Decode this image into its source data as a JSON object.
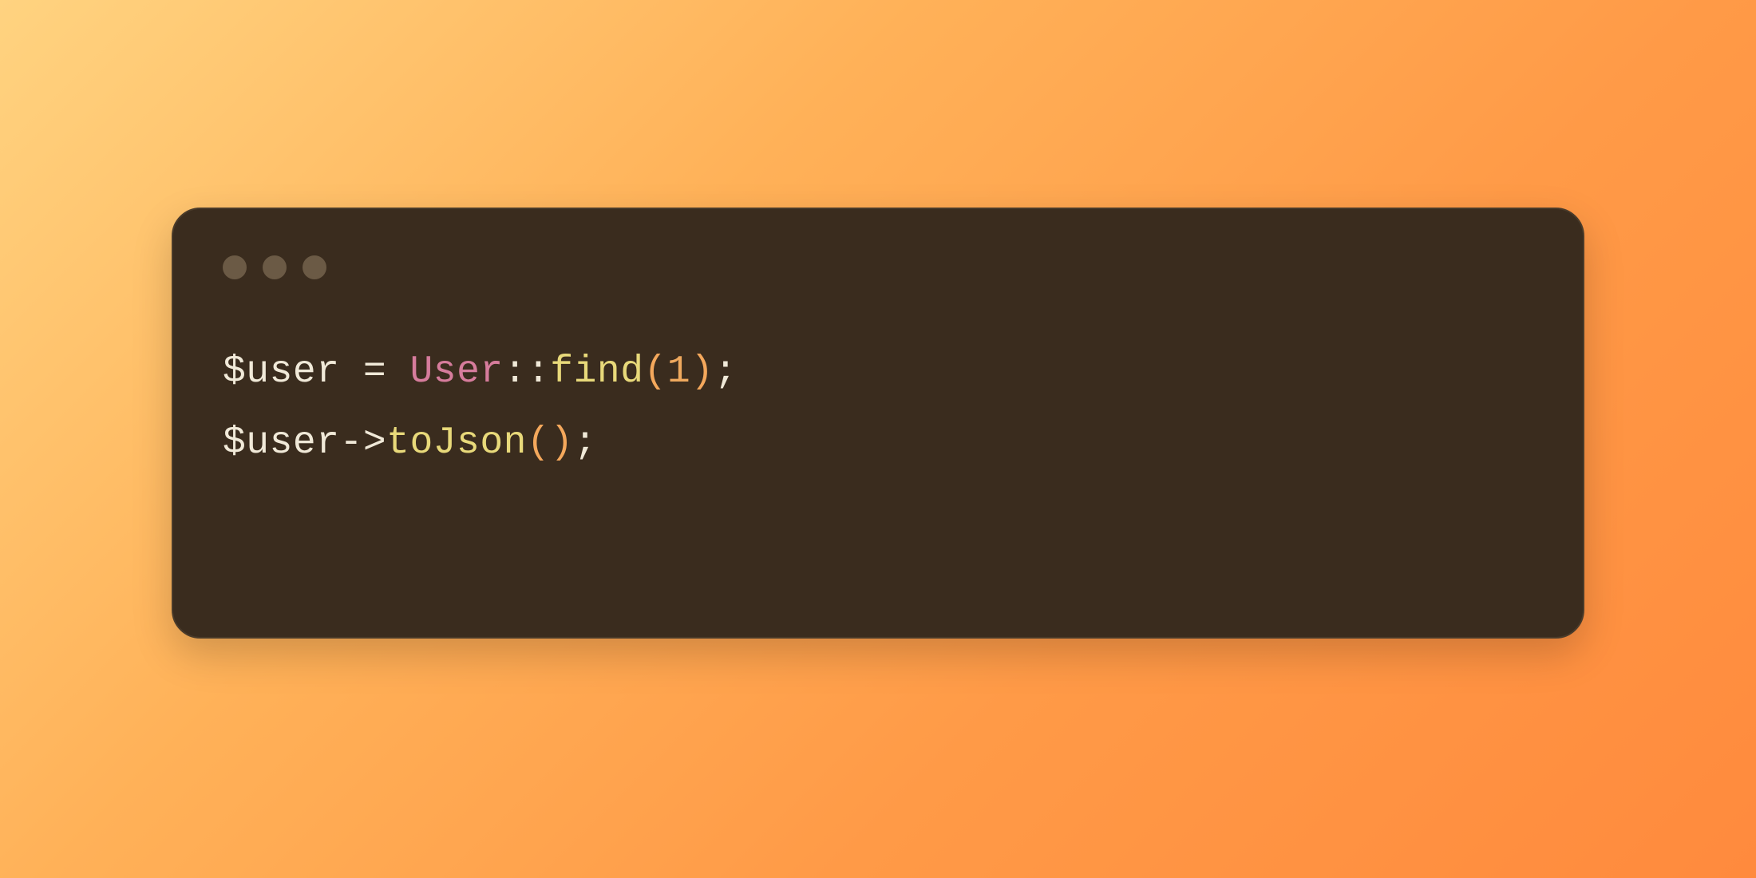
{
  "window": {
    "traffic_lights": 3
  },
  "code": {
    "line1": {
      "var": "$user",
      "space1": " ",
      "assign": "=",
      "space2": " ",
      "class": "User",
      "static": "::",
      "func": "find",
      "lparen": "(",
      "num": "1",
      "rparen": ")",
      "semi": ";"
    },
    "line2": {
      "var": "$user",
      "arrow": "->",
      "func": "toJson",
      "lparen": "(",
      "rparen": ")",
      "semi": ";"
    }
  }
}
